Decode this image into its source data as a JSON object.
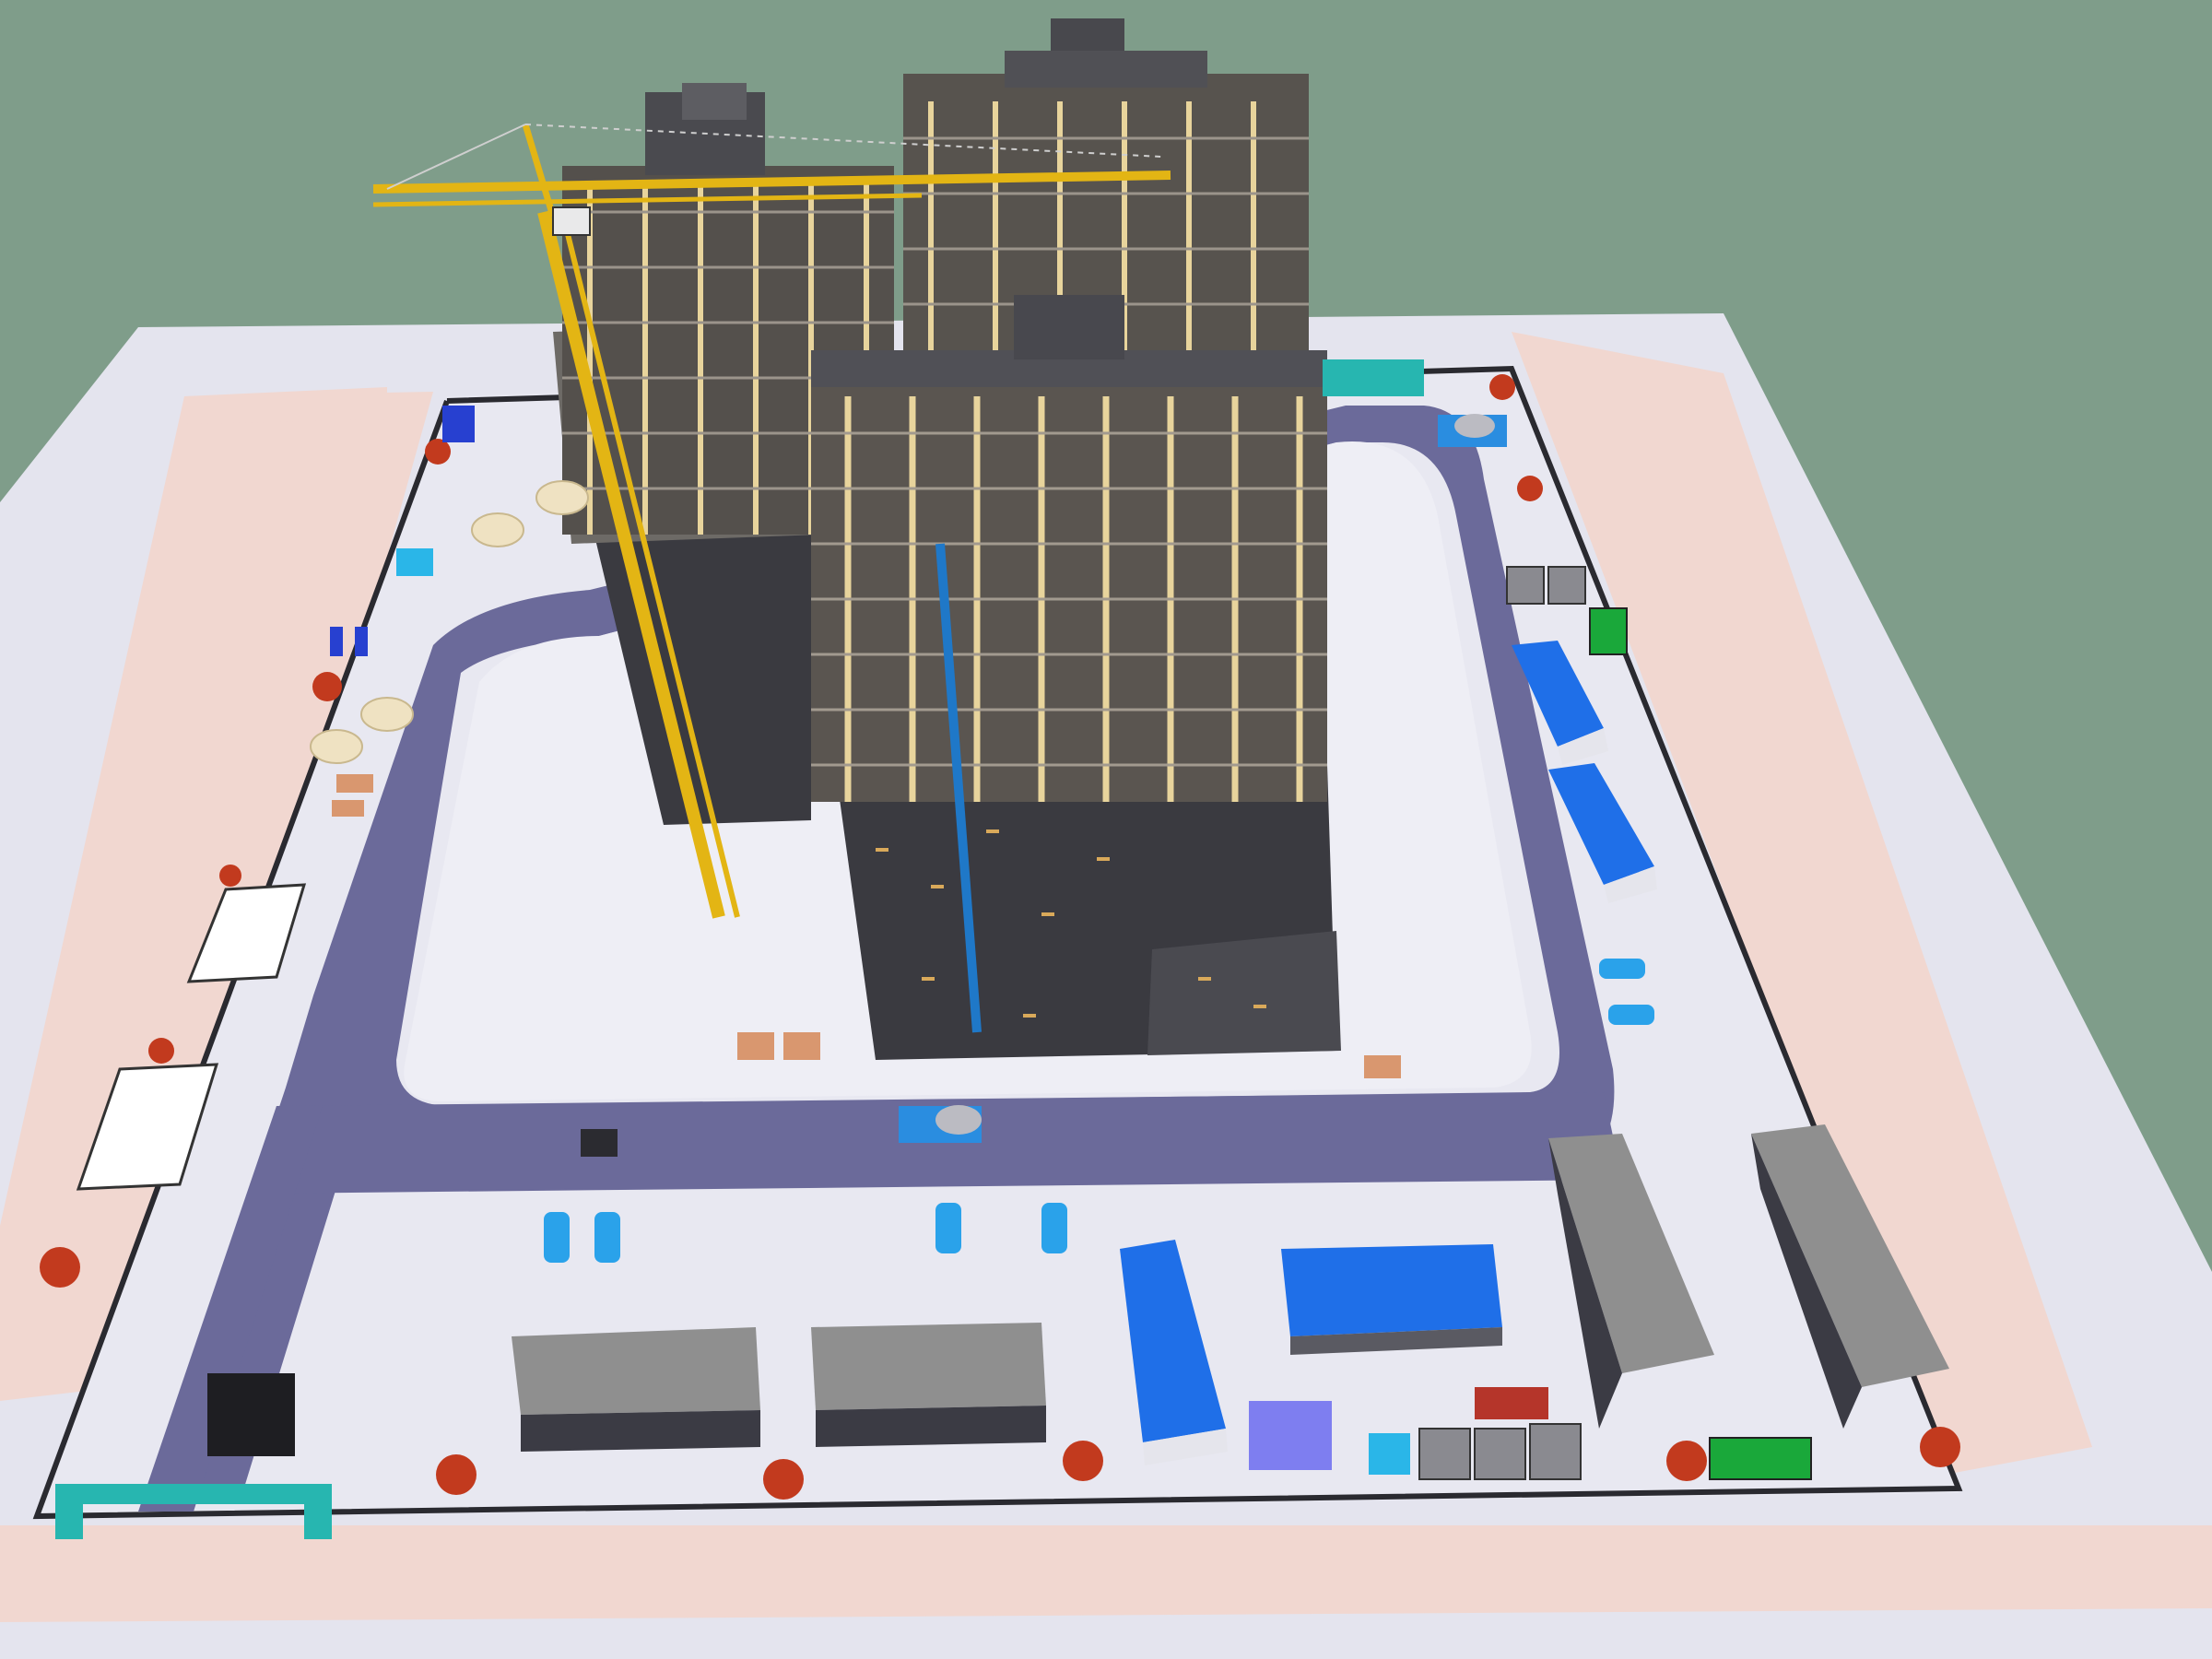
{
  "scene": {
    "kind": "3d-construction-site-rendering",
    "colors": {
      "sky": "#7f9d8a",
      "ground": "#e8e8f0",
      "sidewalk": "#f2d9d2",
      "road": "#6b6a9a",
      "tower_dark": "#3f3f44",
      "tower_frame": "#e7d39a",
      "crane": "#e3b514",
      "blue_roof": "#1f6fe8",
      "grey_roof": "#8f8f8f",
      "tree": "#c23a1e",
      "teal_gate": "#27b6b0"
    },
    "icons": [
      "tower-crane",
      "concrete-mixer-truck",
      "temporary-shed",
      "site-gate",
      "tree",
      "parked-car",
      "fence"
    ]
  }
}
